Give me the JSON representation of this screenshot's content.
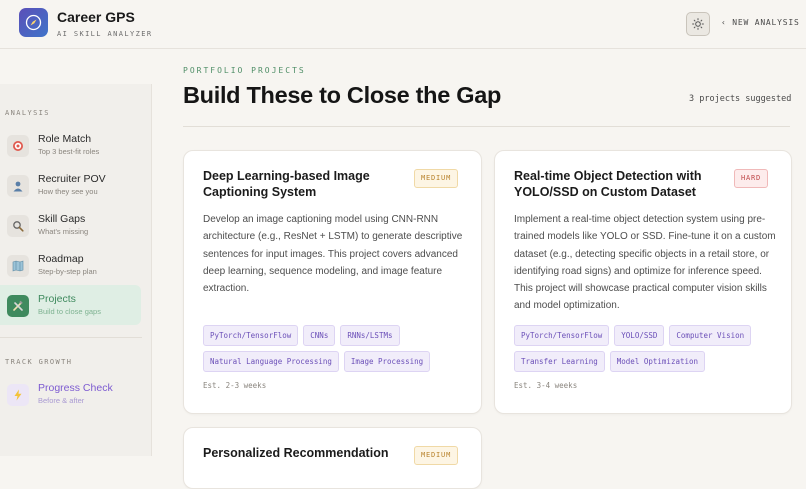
{
  "header": {
    "title": "Career GPS",
    "subtitle": "AI SKILL ANALYZER",
    "new_analysis": "‹ NEW ANALYSIS"
  },
  "sidebar": {
    "section_analysis": "ANALYSIS",
    "section_track": "TRACK GROWTH",
    "items": [
      {
        "label": "Role Match",
        "desc": "Top 3 best-fit roles",
        "icon": "target-icon"
      },
      {
        "label": "Recruiter POV",
        "desc": "How they see you",
        "icon": "person-icon"
      },
      {
        "label": "Skill Gaps",
        "desc": "What's missing",
        "icon": "magnifier-icon"
      },
      {
        "label": "Roadmap",
        "desc": "Step-by-step plan",
        "icon": "roadmap-icon"
      },
      {
        "label": "Projects",
        "desc": "Build to close gaps",
        "icon": "tools-icon",
        "active": true
      },
      {
        "label": "Progress Check",
        "desc": "Before & after",
        "icon": "lightning-icon"
      }
    ]
  },
  "main": {
    "eyebrow": "PORTFOLIO PROJECTS",
    "title": "Build These to Close the Gap",
    "count": "3 projects suggested",
    "projects": [
      {
        "title": "Deep Learning-based Image Captioning System",
        "difficulty": "MEDIUM",
        "description": "Develop an image captioning model using CNN-RNN architecture (e.g., ResNet + LSTM) to generate descriptive sentences for input images. This project covers advanced deep learning, sequence modeling, and image feature extraction.",
        "tags": [
          "PyTorch/TensorFlow",
          "CNNs",
          "RNNs/LSTMs",
          "Natural Language Processing",
          "Image Processing"
        ],
        "estimate": "Est. 2-3 weeks"
      },
      {
        "title": "Real-time Object Detection with YOLO/SSD on Custom Dataset",
        "difficulty": "HARD",
        "description": "Implement a real-time object detection system using pre-trained models like YOLO or SSD. Fine-tune it on a custom dataset (e.g., detecting specific objects in a retail store, or identifying road signs) and optimize for inference speed. This project will showcase practical computer vision skills and model optimization.",
        "tags": [
          "PyTorch/TensorFlow",
          "YOLO/SSD",
          "Computer Vision",
          "Transfer Learning",
          "Model Optimization"
        ],
        "estimate": "Est. 3-4 weeks"
      },
      {
        "title": "Personalized Recommendation",
        "difficulty": "MEDIUM"
      }
    ]
  },
  "colors": {
    "accent_green": "#3f8a5e",
    "accent_purple": "#7d5bd1",
    "badge_medium": "#b98530",
    "badge_hard": "#c0494b"
  }
}
